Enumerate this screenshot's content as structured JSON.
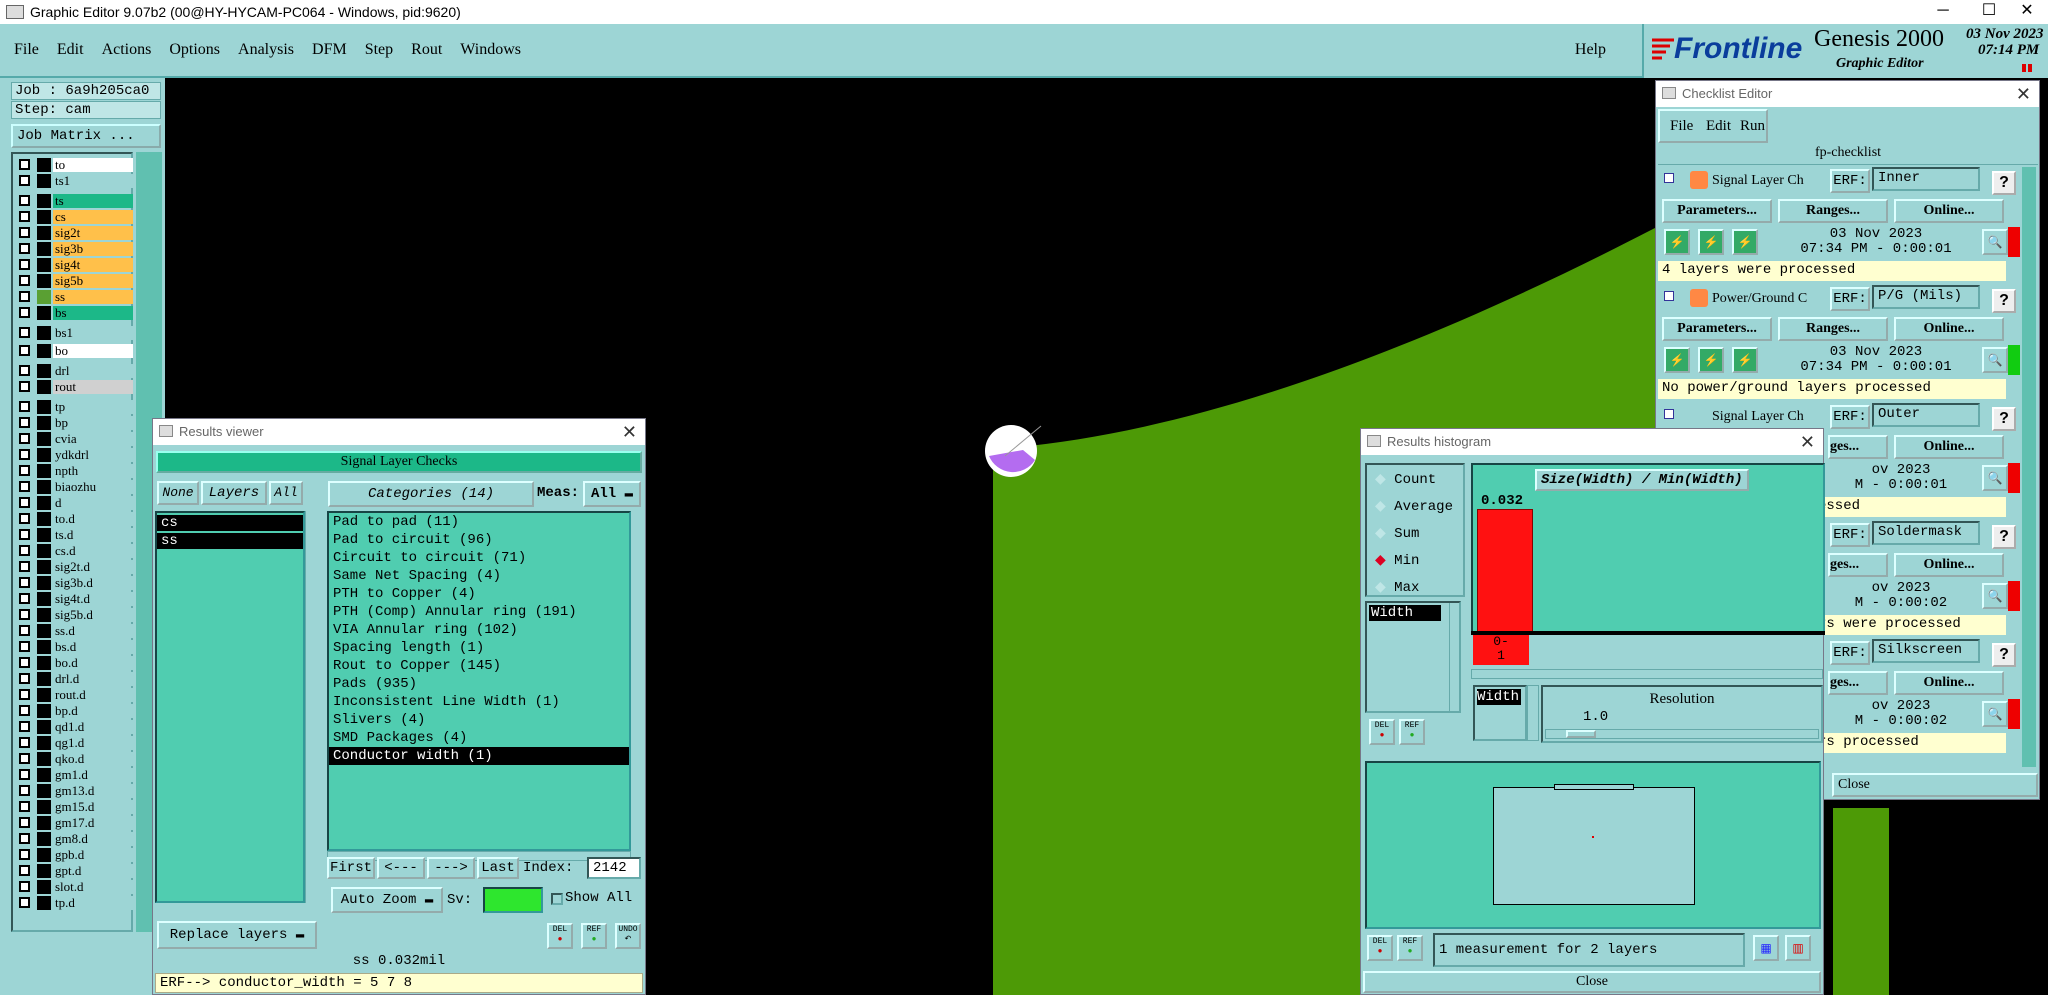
{
  "app": {
    "title": "Graphic Editor 9.07b2 (00@HY-HYCAM-PC064 - Windows, pid:9620)",
    "win_min": "─",
    "win_max": "☐",
    "win_close": "✕"
  },
  "menu": {
    "items": [
      "File",
      "Edit",
      "Actions",
      "Options",
      "Analysis",
      "DFM",
      "Step",
      "Rout",
      "Windows"
    ],
    "help": "Help"
  },
  "logo": {
    "brand": "Frontline",
    "product": "Genesis 2000",
    "subtitle": "Graphic Editor",
    "date": "03 Nov 2023",
    "time": "07:14 PM"
  },
  "left": {
    "job": "Job : 6a9h205ca0",
    "step": "Step: cam",
    "job_matrix": "Job Matrix ...",
    "layers": [
      {
        "name": "to",
        "color": "#ffffff",
        "swatch": "#000000"
      },
      {
        "name": "ts1",
        "color": "#9dd5d5",
        "swatch": "#000000"
      },
      {
        "name": "ts",
        "color": "#1cb888",
        "swatch": "#000000"
      },
      {
        "name": "cs",
        "color": "#ffc04a",
        "swatch": "#000000"
      },
      {
        "name": "sig2t",
        "color": "#ffc04a",
        "swatch": "#000000"
      },
      {
        "name": "sig3b",
        "color": "#ffc04a",
        "swatch": "#000000"
      },
      {
        "name": "sig4t",
        "color": "#ffc04a",
        "swatch": "#000000"
      },
      {
        "name": "sig5b",
        "color": "#ffc04a",
        "swatch": "#000000"
      },
      {
        "name": "ss",
        "color": "#ffc04a",
        "swatch": "#5aa033"
      },
      {
        "name": "bs",
        "color": "#1cb888",
        "swatch": "#000000"
      },
      {
        "name": "bs1",
        "color": "#9dd5d5",
        "swatch": "#000000"
      },
      {
        "name": "bo",
        "color": "#ffffff",
        "swatch": "#000000"
      },
      {
        "name": "drl",
        "color": "#9dd5d5",
        "swatch": "#000000"
      },
      {
        "name": "rout",
        "color": "#d0d0d0",
        "swatch": "#000000"
      },
      {
        "name": "tp",
        "color": "#9dd5d5",
        "swatch": "#000000"
      },
      {
        "name": "bp",
        "color": "#9dd5d5",
        "swatch": "#000000"
      },
      {
        "name": "cvia",
        "color": "#9dd5d5",
        "swatch": "#000000"
      },
      {
        "name": "ydkdrl",
        "color": "#9dd5d5",
        "swatch": "#000000"
      },
      {
        "name": "npth",
        "color": "#9dd5d5",
        "swatch": "#000000"
      },
      {
        "name": "biaozhu",
        "color": "#9dd5d5",
        "swatch": "#000000"
      },
      {
        "name": "d",
        "color": "#9dd5d5",
        "swatch": "#000000"
      },
      {
        "name": "to.d",
        "color": "#9dd5d5",
        "swatch": "#000000"
      },
      {
        "name": "ts.d",
        "color": "#9dd5d5",
        "swatch": "#000000"
      },
      {
        "name": "cs.d",
        "color": "#9dd5d5",
        "swatch": "#000000"
      },
      {
        "name": "sig2t.d",
        "color": "#9dd5d5",
        "swatch": "#000000"
      },
      {
        "name": "sig3b.d",
        "color": "#9dd5d5",
        "swatch": "#000000"
      },
      {
        "name": "sig4t.d",
        "color": "#9dd5d5",
        "swatch": "#000000"
      },
      {
        "name": "sig5b.d",
        "color": "#9dd5d5",
        "swatch": "#000000"
      },
      {
        "name": "ss.d",
        "color": "#9dd5d5",
        "swatch": "#000000"
      },
      {
        "name": "bs.d",
        "color": "#9dd5d5",
        "swatch": "#000000"
      },
      {
        "name": "bo.d",
        "color": "#9dd5d5",
        "swatch": "#000000"
      },
      {
        "name": "drl.d",
        "color": "#9dd5d5",
        "swatch": "#000000"
      },
      {
        "name": "rout.d",
        "color": "#9dd5d5",
        "swatch": "#000000"
      },
      {
        "name": "bp.d",
        "color": "#9dd5d5",
        "swatch": "#000000"
      },
      {
        "name": "qd1.d",
        "color": "#9dd5d5",
        "swatch": "#000000"
      },
      {
        "name": "qg1.d",
        "color": "#9dd5d5",
        "swatch": "#000000"
      },
      {
        "name": "qko.d",
        "color": "#9dd5d5",
        "swatch": "#000000"
      },
      {
        "name": "gm1.d",
        "color": "#9dd5d5",
        "swatch": "#000000"
      },
      {
        "name": "gm13.d",
        "color": "#9dd5d5",
        "swatch": "#000000"
      },
      {
        "name": "gm15.d",
        "color": "#9dd5d5",
        "swatch": "#000000"
      },
      {
        "name": "gm17.d",
        "color": "#9dd5d5",
        "swatch": "#000000"
      },
      {
        "name": "gm8.d",
        "color": "#9dd5d5",
        "swatch": "#000000"
      },
      {
        "name": "gpb.d",
        "color": "#9dd5d5",
        "swatch": "#000000"
      },
      {
        "name": "gpt.d",
        "color": "#9dd5d5",
        "swatch": "#000000"
      },
      {
        "name": "slot.d",
        "color": "#9dd5d5",
        "swatch": "#000000"
      },
      {
        "name": "tp.d",
        "color": "#9dd5d5",
        "swatch": "#000000"
      }
    ]
  },
  "results_viewer": {
    "window_title": "Results viewer",
    "header": "Signal Layer Checks",
    "none": "None",
    "layers": "Layers",
    "all": "All",
    "categories_btn": "Categories (14)",
    "meas_label": "Meas:",
    "meas_value": "All",
    "layer_items": [
      "cs",
      "ss"
    ],
    "categories": [
      "Pad to pad (11)",
      "Pad to circuit (96)",
      "Circuit to circuit (71)",
      "Same Net Spacing (4)",
      "PTH to Copper (4)",
      "PTH (Comp) Annular ring (191)",
      "VIA Annular ring (102)",
      "Spacing length (1)",
      "Rout to Copper (145)",
      "Pads (935)",
      "Inconsistent Line Width (1)",
      "Slivers (4)",
      "SMD Packages (4)",
      "Conductor width (1)"
    ],
    "selected_index": 13,
    "first": "First",
    "prev": "<---",
    "next": "--->",
    "last": "Last",
    "index_label": "Index:",
    "index_value": "2142",
    "auto_zoom": "Auto Zoom",
    "sv_label": "Sv:",
    "show_all": "Show All",
    "replace_layers": "Replace layers",
    "del": "DEL",
    "ref": "REF",
    "undo": "UNDO",
    "status": "ss 0.032mil",
    "erf_line": "ERF--> conductor_width = 5 7 8"
  },
  "checklist": {
    "window_title": "Checklist Editor",
    "menu": [
      "File",
      "Edit",
      "Run"
    ],
    "name": "fp-checklist",
    "erf_label": "ERF:",
    "parameters": "Parameters...",
    "ranges": "Ranges...",
    "online": "Online...",
    "close": "Close",
    "actions": [
      {
        "name": "Signal Layer Ch",
        "erf": "Inner",
        "date": "03 Nov 2023",
        "time": "07:34 PM - 0:00:01",
        "msg": "4 layers were processed",
        "status": "red"
      },
      {
        "name": "Power/Ground C",
        "erf": "P/G (Mils)",
        "date": "03 Nov 2023",
        "time": "07:34 PM - 0:00:01",
        "msg": "No power/ground layers processed",
        "status": "green"
      },
      {
        "name": "Signal Layer Ch",
        "erf": "Outer",
        "date": "ov 2023",
        "time": "M - 0:00:01",
        "msg": "essed",
        "status": "red",
        "ranges": "ges...",
        "online": "Online..."
      },
      {
        "name": "",
        "erf": "Soldermask",
        "date": "ov 2023",
        "time": "M - 0:00:02",
        "msg": "rs were processed",
        "status": "red",
        "ranges": "ges...",
        "online": "Online..."
      },
      {
        "name": "",
        "erf": "Silkscreen",
        "date": "ov 2023",
        "time": "M - 0:00:02",
        "msg": "rs processed",
        "status": "red",
        "ranges": "ges...",
        "online": "Online..."
      }
    ]
  },
  "histogram": {
    "window_title": "Results histogram",
    "modes": [
      "Count",
      "Average",
      "Sum",
      "Min",
      "Max"
    ],
    "selected_mode": "Min",
    "list_item": "Width",
    "chart_title": "Size(Width) / Min(Width)",
    "bar_value": "0.032",
    "bar_label_1": "0-",
    "bar_label_2": "1",
    "resolution_field": "Width",
    "resolution_label": "Resolution",
    "resolution_value": "1.0",
    "measurement": "1 measurement for 2 layers",
    "close": "Close",
    "del": "DEL",
    "ref": "REF"
  },
  "colors": {
    "panel": "#9dd5d5",
    "teal": "#50cdb0",
    "board_green": "#4d9a06",
    "highlight_purple": "#b46cf0"
  }
}
